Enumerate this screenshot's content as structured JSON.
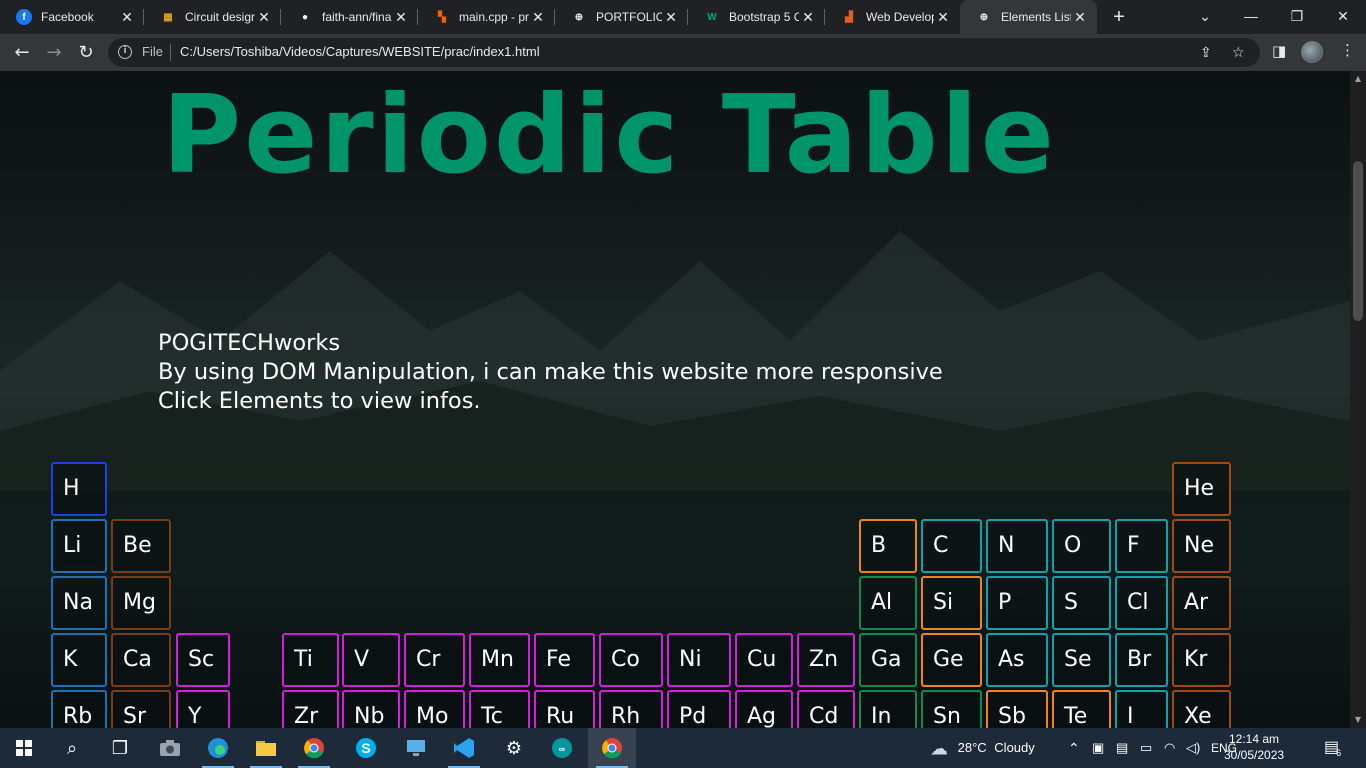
{
  "browser": {
    "tabs": [
      {
        "title": "Facebook",
        "icon": "facebook-icon",
        "color": "#1877f2",
        "glyph": "f",
        "active": false
      },
      {
        "title": "Circuit design",
        "icon": "circuit-design-icon",
        "color": "#e0a020",
        "glyph": "▦",
        "active": false
      },
      {
        "title": "faith-ann/fina",
        "icon": "github-icon",
        "color": "#ffffff",
        "glyph": "●",
        "active": false
      },
      {
        "title": "main.cpp - pr",
        "icon": "replit-icon",
        "color": "#f26207",
        "glyph": "▚",
        "active": false
      },
      {
        "title": "PORTFOLIO",
        "icon": "globe-icon",
        "color": "#e8eaed",
        "glyph": "⊕",
        "active": false
      },
      {
        "title": "Bootstrap 5 C",
        "icon": "w3schools-icon",
        "color": "#04aa6d",
        "glyph": "W",
        "active": false
      },
      {
        "title": "Web Develop",
        "icon": "web-develop-icon",
        "color": "#e06020",
        "glyph": "▟",
        "active": false
      },
      {
        "title": "Elements Lists",
        "icon": "globe-icon",
        "color": "#e8eaed",
        "glyph": "⊕",
        "active": true
      }
    ],
    "address": {
      "scheme": "File",
      "url": "C:/Users/Toshiba/Videos/Captures/WEBSITE/prac/index1.html"
    }
  },
  "page": {
    "title": "Periodic Table",
    "intro": [
      "POGITECHworks",
      "By using DOM Manipulation, i can make this website more responsive",
      "Click Elements to view infos."
    ],
    "elements": [
      {
        "symbol": "H",
        "group": "hydrogen"
      },
      {
        "symbol": "He",
        "group": "noble"
      },
      {
        "symbol": "Li",
        "group": "alkali"
      },
      {
        "symbol": "Be",
        "group": "alkaline"
      },
      {
        "symbol": "B",
        "group": "metalloid"
      },
      {
        "symbol": "C",
        "group": "nonmetal"
      },
      {
        "symbol": "N",
        "group": "nonmetal"
      },
      {
        "symbol": "O",
        "group": "nonmetal"
      },
      {
        "symbol": "F",
        "group": "nonmetal"
      },
      {
        "symbol": "Ne",
        "group": "noble"
      },
      {
        "symbol": "Na",
        "group": "alkali"
      },
      {
        "symbol": "Mg",
        "group": "alkaline"
      },
      {
        "symbol": "Al",
        "group": "posttrans"
      },
      {
        "symbol": "Si",
        "group": "metalloid"
      },
      {
        "symbol": "P",
        "group": "nonmetal"
      },
      {
        "symbol": "S",
        "group": "nonmetal"
      },
      {
        "symbol": "Cl",
        "group": "nonmetal"
      },
      {
        "symbol": "Ar",
        "group": "noble"
      },
      {
        "symbol": "K",
        "group": "alkali"
      },
      {
        "symbol": "Ca",
        "group": "alkaline"
      },
      {
        "symbol": "Sc",
        "group": "transition"
      },
      {
        "symbol": "Ti",
        "group": "transition"
      },
      {
        "symbol": "V",
        "group": "transition"
      },
      {
        "symbol": "Cr",
        "group": "transition"
      },
      {
        "symbol": "Mn",
        "group": "transition"
      },
      {
        "symbol": "Fe",
        "group": "transition"
      },
      {
        "symbol": "Co",
        "group": "transition"
      },
      {
        "symbol": "Ni",
        "group": "transition"
      },
      {
        "symbol": "Cu",
        "group": "transition"
      },
      {
        "symbol": "Zn",
        "group": "transition"
      },
      {
        "symbol": "Ga",
        "group": "posttrans"
      },
      {
        "symbol": "Ge",
        "group": "metalloid"
      },
      {
        "symbol": "As",
        "group": "nonmetal"
      },
      {
        "symbol": "Se",
        "group": "nonmetal"
      },
      {
        "symbol": "Br",
        "group": "nonmetal"
      },
      {
        "symbol": "Kr",
        "group": "noble"
      },
      {
        "symbol": "Rb",
        "group": "alkali"
      },
      {
        "symbol": "Sr",
        "group": "alkaline"
      },
      {
        "symbol": "Y",
        "group": "transition"
      },
      {
        "symbol": "Zr",
        "group": "transition"
      },
      {
        "symbol": "Nb",
        "group": "transition"
      },
      {
        "symbol": "Mo",
        "group": "transition"
      },
      {
        "symbol": "Tc",
        "group": "transition"
      },
      {
        "symbol": "Ru",
        "group": "transition"
      },
      {
        "symbol": "Rh",
        "group": "transition"
      },
      {
        "symbol": "Pd",
        "group": "transition"
      },
      {
        "symbol": "Ag",
        "group": "transition"
      },
      {
        "symbol": "Cd",
        "group": "transition"
      },
      {
        "symbol": "In",
        "group": "posttrans"
      },
      {
        "symbol": "Sn",
        "group": "posttrans"
      },
      {
        "symbol": "Sb",
        "group": "metalloid"
      },
      {
        "symbol": "Te",
        "group": "metalloid"
      },
      {
        "symbol": "I",
        "group": "nonmetal"
      },
      {
        "symbol": "Xe",
        "group": "noble"
      }
    ],
    "colors": {
      "title": "#00946a",
      "hydrogen": "#1f3ee6",
      "alkali": "#1a72b5",
      "alkaline": "#7a3d12",
      "transition": "#d020d8",
      "posttrans": "#0c8a50",
      "metalloid": "#f08418",
      "nonmetal": "#14a0a8",
      "noble": "#a04a12"
    }
  },
  "taskbar": {
    "apps": [
      "windows-start-icon",
      "search-icon",
      "task-view-icon",
      "camera-icon",
      "edge-icon",
      "file-explorer-icon",
      "chrome-icon",
      "skype-icon",
      "remote-desktop-icon",
      "vscode-icon",
      "settings-icon",
      "arduino-icon",
      "chrome-profile-icon"
    ],
    "weather": {
      "temp": "28°C",
      "condition": "Cloudy"
    },
    "language": "ENG",
    "time": "12:14 am",
    "date": "30/05/2023",
    "notifications": "6"
  }
}
